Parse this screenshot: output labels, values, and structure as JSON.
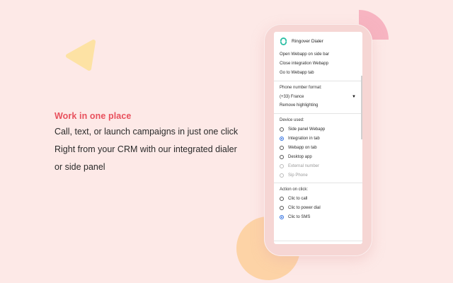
{
  "colors": {
    "background": "#fde9e7",
    "headline": "#e8515d",
    "triangle": "#fde2a4",
    "pink_shape": "#f7b4c1",
    "orange_circle": "#fdd3a6",
    "radio_selected": "#2f6fe0"
  },
  "marketing": {
    "headline": "Work in one place",
    "lines": [
      "Call, text, or launch campaigns in just one click",
      "Right from your CRM with our integrated dialer",
      "or side panel"
    ]
  },
  "panel": {
    "app_icon": "ringover-logo-icon",
    "app_title": "Ringover Dialer",
    "menu_items": [
      "Open Webapp on side bar",
      "Close integration Webapp",
      "Go to Webapp tab"
    ],
    "phone_format": {
      "label": "Phone number format:",
      "selected": "(+33) France",
      "remove_highlighting": "Remove highlighting"
    },
    "device": {
      "label": "Device used:",
      "options": [
        {
          "label": "Side panel Webapp",
          "checked": false,
          "disabled": false
        },
        {
          "label": "Integration in tab",
          "checked": true,
          "disabled": false
        },
        {
          "label": "Webapp on tab",
          "checked": false,
          "disabled": false
        },
        {
          "label": "Desktop app",
          "checked": false,
          "disabled": false
        },
        {
          "label": "External number",
          "checked": false,
          "disabled": true
        },
        {
          "label": "Sip Phone",
          "checked": false,
          "disabled": true
        }
      ]
    },
    "action": {
      "label": "Action on click:",
      "options": [
        {
          "label": "Clic to call",
          "checked": false,
          "disabled": false
        },
        {
          "label": "Clic to power dial",
          "checked": false,
          "disabled": false
        },
        {
          "label": "Clic to SMS",
          "checked": true,
          "disabled": false
        }
      ]
    }
  }
}
